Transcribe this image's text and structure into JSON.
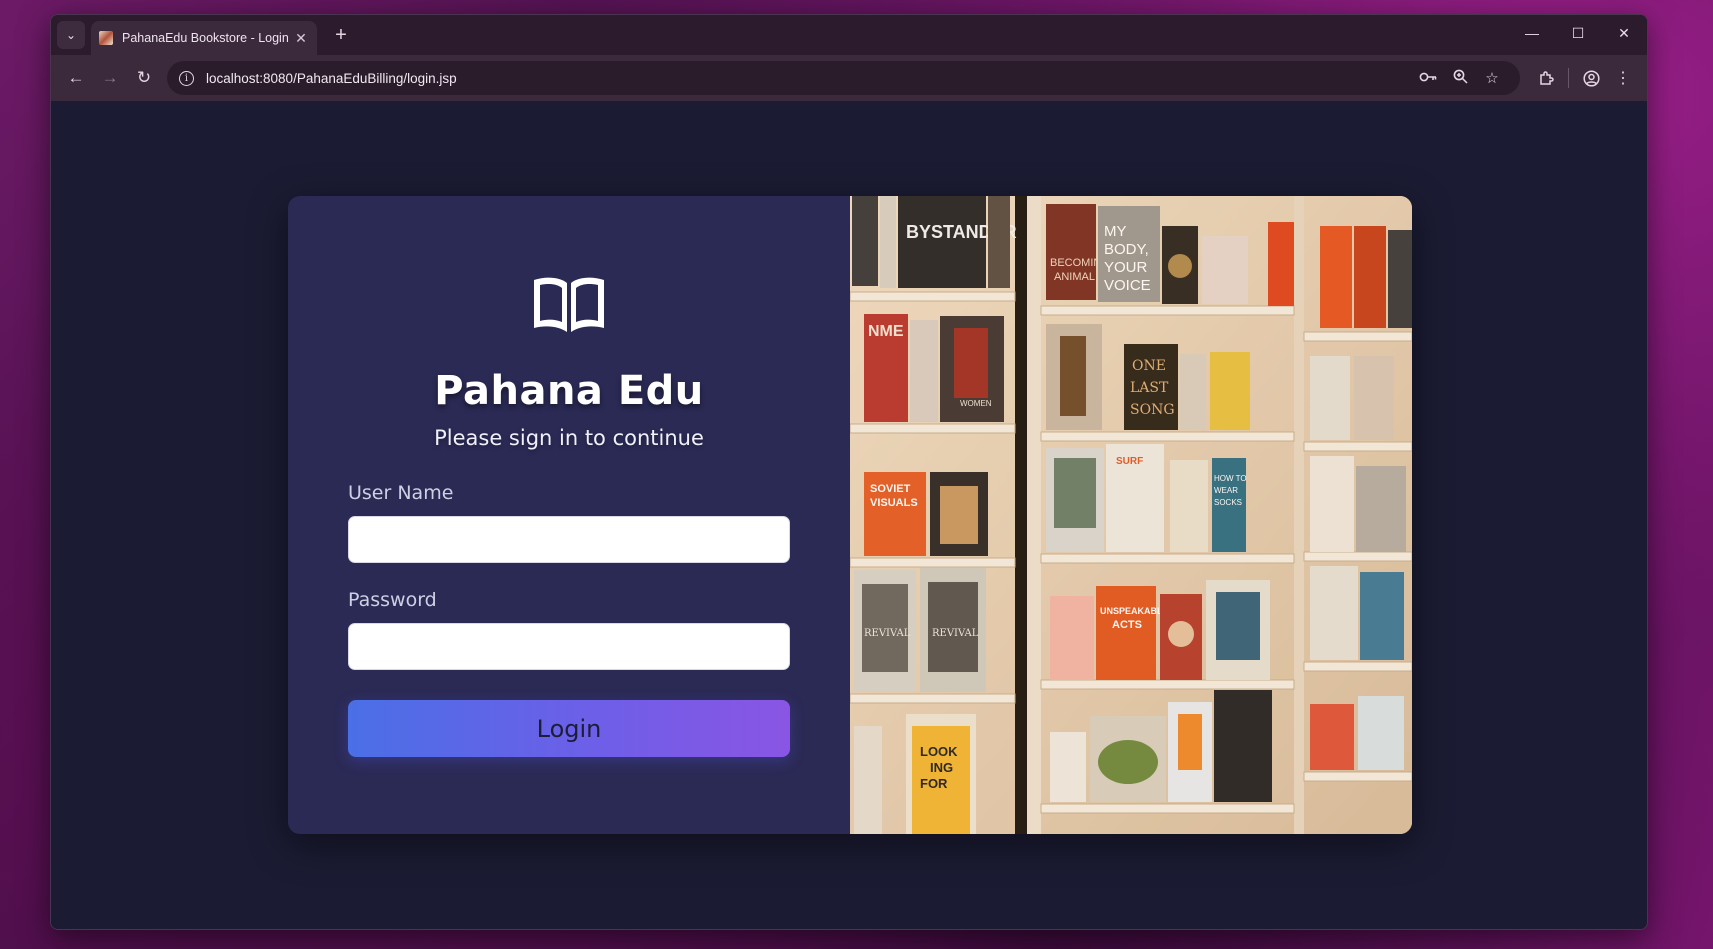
{
  "browser": {
    "tab_title": "PahanaEdu Bookstore - Login",
    "tab_close": "✕",
    "new_tab": "+",
    "url": "localhost:8080/PahanaEduBilling/login.jsp",
    "window_controls": {
      "minimize": "—",
      "maximize": "☐",
      "close": "✕"
    },
    "nav": {
      "back": "←",
      "forward": "→",
      "reload": "↻"
    },
    "icons": [
      "password-key-icon",
      "zoom-icon",
      "bookmark-star-icon",
      "extensions-icon",
      "profile-icon",
      "menu-icon"
    ]
  },
  "login": {
    "brand": "Pahana Edu",
    "subtitle": "Please sign in to continue",
    "username_label": "User Name",
    "username_value": "",
    "password_label": "Password",
    "password_value": "",
    "button_label": "Login",
    "logo_icon": "open-book-icon"
  },
  "photo": {
    "subject": "bookstore-shelves-photo",
    "book_titles": [
      "BYSTANDER",
      "MY BODY, YOUR VOICE",
      "BECOMING ANIMAL",
      "NME",
      "WOMEN PHOTOGRAPHERS",
      "ONE LAST SONG",
      "SOVIET VISUALS",
      "SURF",
      "HOW TO WEAR SOCKS",
      "UNSPEAKABLE ACTS",
      "REVIVAL",
      "LOOK ING FOR"
    ]
  },
  "colors": {
    "page_bg": "#1b1b33",
    "panel_bg": "#2b2a55",
    "button_gradient_start": "#4a6fe6",
    "button_gradient_end": "#8a55e4"
  }
}
